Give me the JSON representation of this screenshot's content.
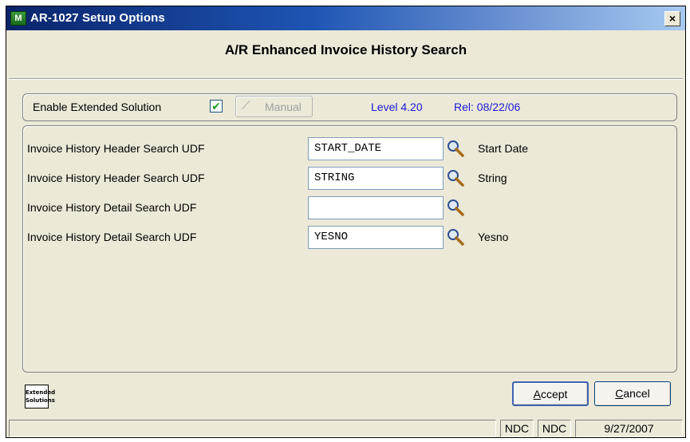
{
  "window": {
    "title": "AR-1027 Setup Options",
    "app_icon_text": "M",
    "close_label": "×"
  },
  "heading": "A/R Enhanced Invoice History Search",
  "setup": {
    "enable_label": "Enable Extended Solution",
    "enable_checked": true,
    "check_mark": "✔",
    "manual_label": "Manual",
    "level": "Level 4.20",
    "release": "Rel: 08/22/06"
  },
  "udfs": [
    {
      "label": "Invoice History Header Search UDF",
      "value": "START_DATE",
      "description": "Start Date"
    },
    {
      "label": "Invoice History Header Search UDF",
      "value": "STRING",
      "description": "String"
    },
    {
      "label": "Invoice History Detail Search UDF",
      "value": "",
      "description": ""
    },
    {
      "label": "Invoice History Detail Search UDF",
      "value": "YESNO",
      "description": "Yesno"
    }
  ],
  "logo": {
    "line1": "Extended",
    "line2": "Solutions"
  },
  "buttons": {
    "accept_key": "A",
    "accept_rest": "ccept",
    "cancel_key": "C",
    "cancel_rest": "ancel"
  },
  "status": {
    "cell1": "NDC",
    "cell2": "NDC",
    "date": "9/27/2007"
  },
  "colors": {
    "title_bar": "#0a246a",
    "accent_blue": "#1a1ad6",
    "check": "#21a121",
    "window_bg": "#ece9d8"
  },
  "icons": {
    "lookup": "magnifier-icon",
    "app": "app-icon",
    "manual": "manual-icon",
    "close": "close-icon"
  }
}
